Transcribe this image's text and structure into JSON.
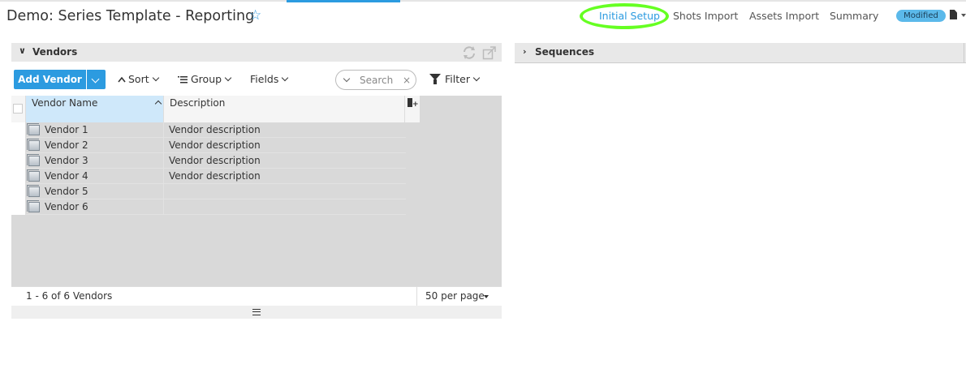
{
  "page": {
    "title": "Demo: Series Template - Reporting",
    "star_glyph": "☆"
  },
  "nav": {
    "items": [
      {
        "label": "Initial Setup",
        "active": true
      },
      {
        "label": "Shots Import",
        "active": false
      },
      {
        "label": "Assets Import",
        "active": false
      },
      {
        "label": "Summary",
        "active": false
      }
    ],
    "status_badge": "Modified"
  },
  "vendors_panel": {
    "title": "Vendors",
    "collapse_glyph": "∨",
    "toolbar": {
      "add_label": "Add Vendor",
      "sort_label": "Sort",
      "group_label": "Group",
      "fields_label": "Fields",
      "search_placeholder": "Search",
      "clear_glyph": "×",
      "filter_label": "Filter"
    },
    "columns": [
      "Vendor Name",
      "Description"
    ],
    "rows": [
      {
        "name": "Vendor 1",
        "description": "Vendor description"
      },
      {
        "name": "Vendor 2",
        "description": "Vendor description"
      },
      {
        "name": "Vendor 3",
        "description": "Vendor description"
      },
      {
        "name": "Vendor 4",
        "description": "Vendor description"
      },
      {
        "name": "Vendor 5",
        "description": ""
      },
      {
        "name": "Vendor 6",
        "description": ""
      }
    ],
    "footer": {
      "record_count": "1 - 6 of 6 Vendors",
      "per_page": "50 per page"
    }
  },
  "sequences_panel": {
    "title": "Sequences",
    "expand_glyph": "›"
  },
  "colors": {
    "accent": "#2c9be0",
    "highlight_ring": "#66ff22",
    "badge": "#5bb9ea"
  }
}
